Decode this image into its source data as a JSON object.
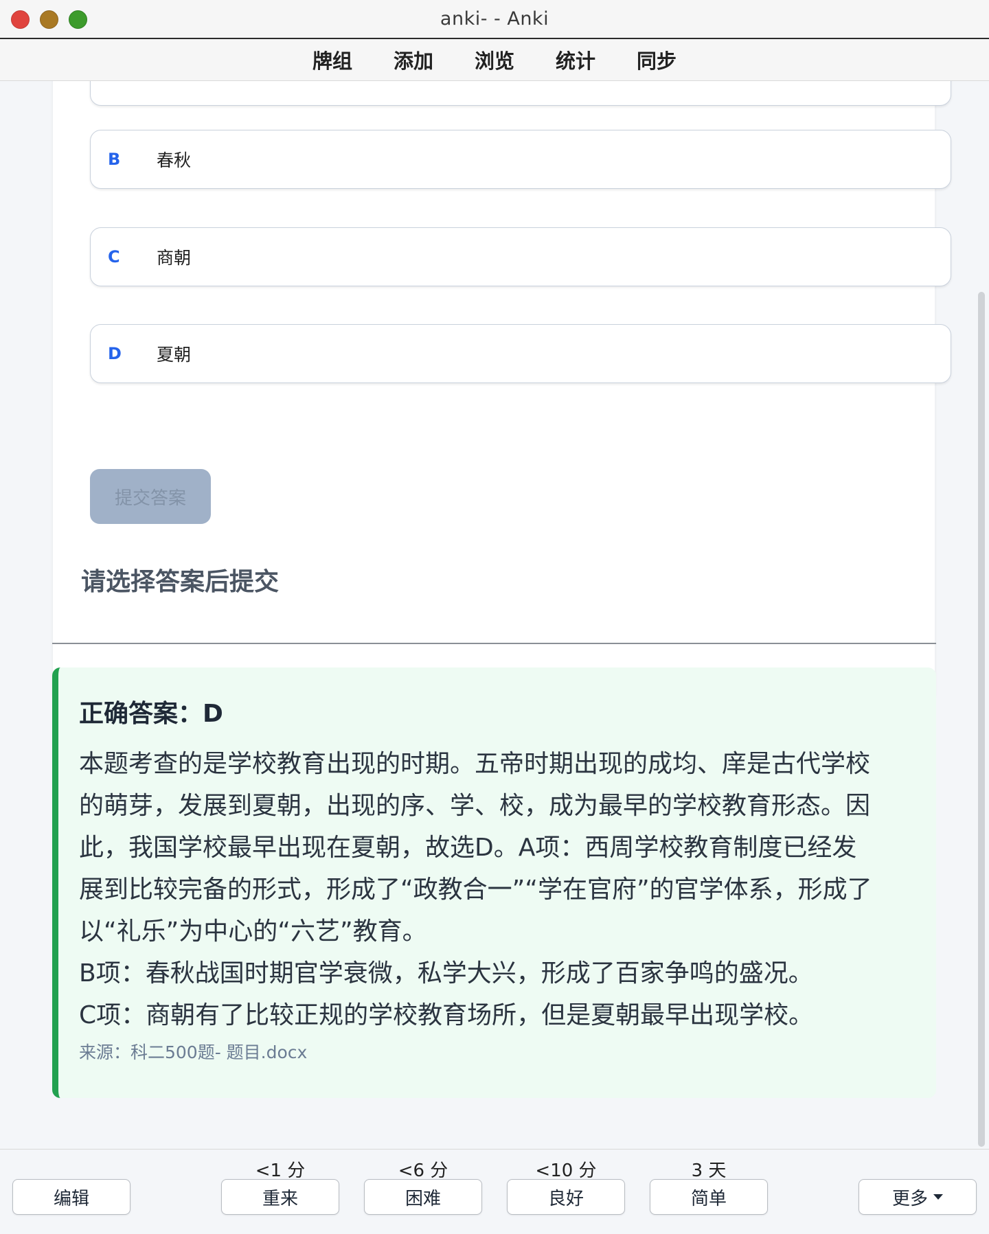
{
  "window": {
    "title": "anki- - Anki"
  },
  "toolbar": {
    "items": [
      "牌组",
      "添加",
      "浏览",
      "统计",
      "同步"
    ]
  },
  "question": {
    "options": [
      {
        "letter": "B",
        "text": "春秋"
      },
      {
        "letter": "C",
        "text": "商朝"
      },
      {
        "letter": "D",
        "text": "夏朝"
      }
    ],
    "submit_label": "提交答案",
    "hint": "请选择答案后提交"
  },
  "answer": {
    "title": "正确答案：D",
    "lines": [
      "本题考查的是学校教育出现的时期。五帝时期出现的成均、庠是古代学校",
      "的萌芽，发展到夏朝，出现的序、学、校，成为最早的学校教育形态。因",
      "此，我国学校最早出现在夏朝，故选D。A项：西周学校教育制度已经发",
      "展到比较完备的形式，形成了“政教合一”“学在官府”的官学体系，形成了",
      "以“礼乐”为中心的“六艺”教育。",
      "B项：春秋战国时期官学衰微，私学大兴，形成了百家争鸣的盛况。",
      "C项：商朝有了比较正规的学校教育场所，但是夏朝最早出现学校。"
    ],
    "source": "来源：科二500题- 题目.docx"
  },
  "bottombar": {
    "edit_label": "编辑",
    "more_label": "更多",
    "ease_buttons": [
      {
        "interval": "<1 分",
        "label": "重来"
      },
      {
        "interval": "<6 分",
        "label": "困难"
      },
      {
        "interval": "<10 分",
        "label": "良好"
      },
      {
        "interval": "3 天",
        "label": "简单"
      }
    ]
  },
  "colors": {
    "accent_blue": "#2563eb",
    "answer_border": "#22a150",
    "answer_bg": "#eefbf3",
    "submit_disabled": "#a0b1c8"
  }
}
